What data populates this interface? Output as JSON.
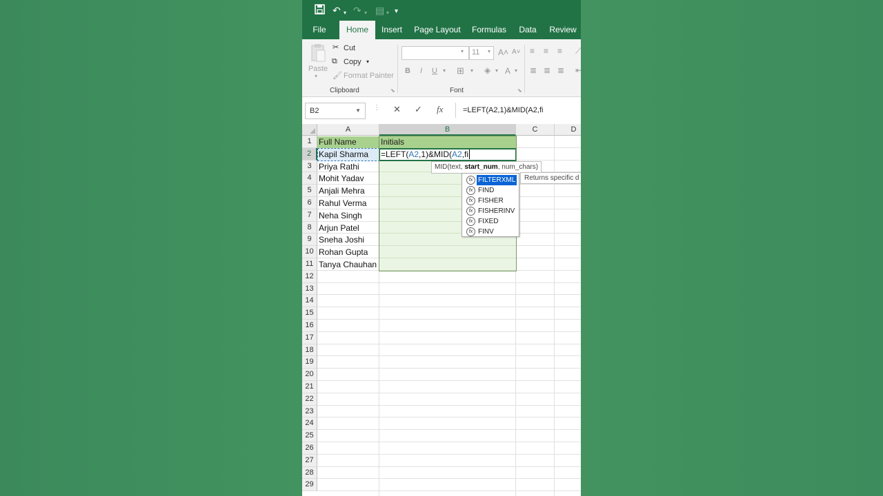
{
  "quick_access": {
    "save_icon": "floppy-disk-icon",
    "undo_icon": "undo-icon",
    "redo_icon": "redo-icon",
    "customize_icon": "caret-down-icon"
  },
  "tabs": [
    "File",
    "Home",
    "Insert",
    "Page Layout",
    "Formulas",
    "Data",
    "Review"
  ],
  "active_tab": "Home",
  "ribbon": {
    "paste_label": "Paste",
    "cut_label": "Cut",
    "copy_label": "Copy",
    "format_painter_label": "Format Painter",
    "clipboard_group": "Clipboard",
    "font_group": "Font",
    "font_size": "11",
    "bold": "B",
    "italic": "I",
    "underline": "U"
  },
  "formula_bar": {
    "name_box": "B2",
    "cancel_glyph": "✕",
    "enter_glyph": "✓",
    "fx_glyph": "fx",
    "formula": "=LEFT(A2,1)&MID(A2,fi"
  },
  "columns": [
    "A",
    "B",
    "C",
    "D"
  ],
  "rows": [
    "1",
    "2",
    "3",
    "4",
    "5",
    "6",
    "7",
    "8",
    "9",
    "10",
    "11",
    "12",
    "13",
    "14",
    "15",
    "16",
    "17",
    "18",
    "19",
    "20",
    "21",
    "22",
    "23",
    "24",
    "25",
    "26",
    "27",
    "28",
    "29"
  ],
  "sheet": {
    "header_a": "Full Name",
    "header_b": "Initials",
    "names": [
      "Kapil Sharma",
      "Priya Rathi",
      "Mohit Yadav",
      "Anjali Mehra",
      "Rahul Verma",
      "Neha Singh",
      "Arjun Patel",
      "Sneha Joshi",
      "Rohan Gupta",
      "Tanya Chauhan"
    ],
    "b2_edit": {
      "p1": "=LEFT(",
      "r1": "A2",
      "p2": ",1)&MID(",
      "r2": "A2",
      "p3": ",fi"
    }
  },
  "tooltip": {
    "pre": "MID(text, ",
    "bold": "start_num",
    "post": ", num_chars)"
  },
  "autocomplete": [
    "FILTERXML",
    "FIND",
    "FISHER",
    "FISHERINV",
    "FIXED",
    "FINV"
  ],
  "autocomplete_description": "Returns specific d",
  "colors": {
    "excel_green": "#217346",
    "header_fill": "#a9d18e",
    "initials_fill": "#ebf5e4",
    "selection_blue": "#0a64d6"
  }
}
